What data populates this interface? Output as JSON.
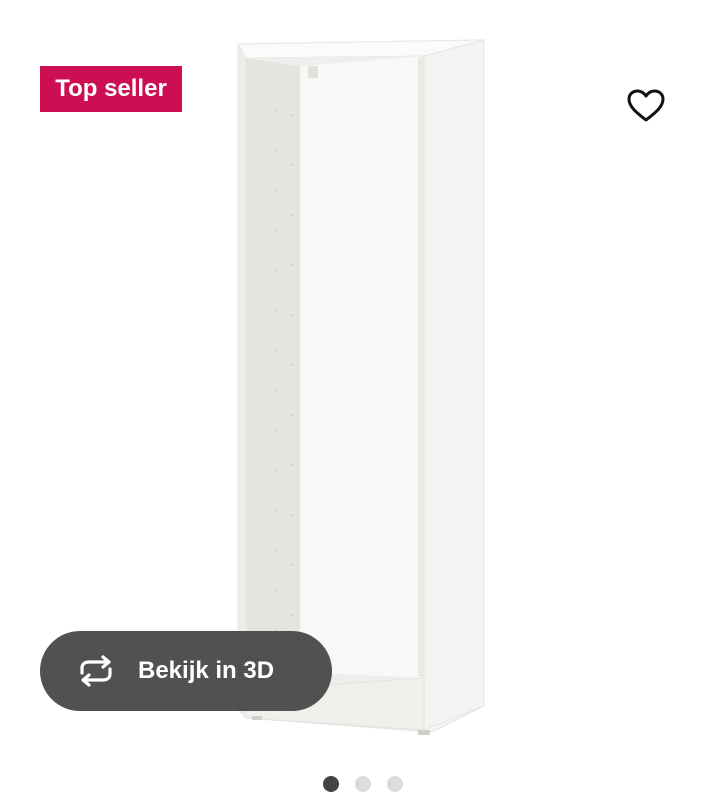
{
  "badge": {
    "label": "Top seller",
    "color": "#cc0e52"
  },
  "wishlist": {
    "icon": "heart-icon"
  },
  "view_3d": {
    "label": "Bekijk in 3D",
    "icon": "rotate-arrows-icon"
  },
  "carousel": {
    "slides": 3,
    "active_index": 0
  },
  "product": {
    "image": "white-shelf-frame"
  }
}
